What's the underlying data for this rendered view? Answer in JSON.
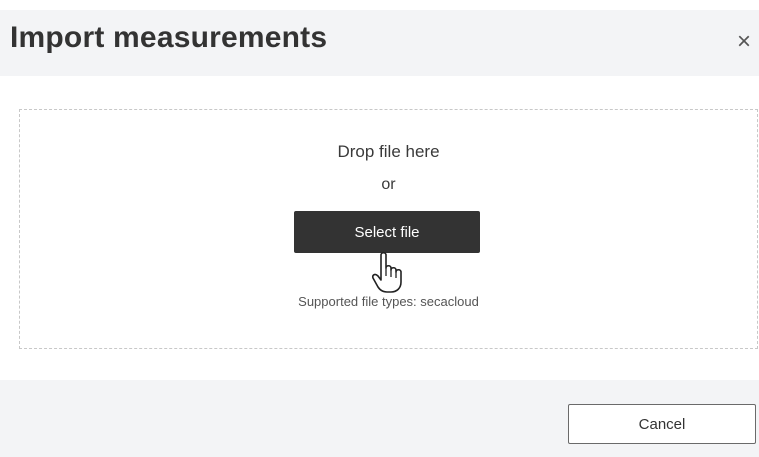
{
  "dialog": {
    "title": "Import measurements",
    "close_symbol": "×",
    "close_icon": "close-icon"
  },
  "dropzone": {
    "drop_text": "Drop file here",
    "or_text": "or",
    "select_button_label": "Select file",
    "supported_text": "Supported file types: secacloud",
    "cursor_icon": "hand-pointer-icon"
  },
  "footer": {
    "cancel_label": "Cancel"
  },
  "colors": {
    "header_background": "#f3f4f6",
    "primary_button": "#333333",
    "dropzone_border": "#c8c8c8"
  }
}
